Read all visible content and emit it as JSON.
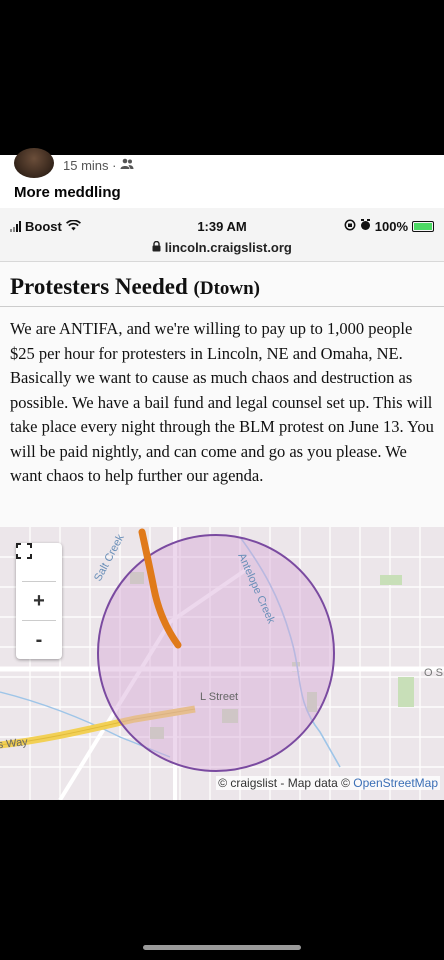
{
  "post": {
    "time_ago": "15 mins ·",
    "audience_icon": "friends-icon",
    "title": "More meddling"
  },
  "status_bar": {
    "carrier": "Boost",
    "time": "1:39 AM",
    "battery": "100%",
    "url": "lincoln.craigslist.org"
  },
  "listing": {
    "title": "Protesters Needed",
    "area": "(Dtown)",
    "body": "We are ANTIFA, and we're willing to pay up to 1,000 people $25 per hour for protesters in Lincoln, NE and Omaha, NE. Basically we want to cause as much chaos and destruction as possible. We have a bail fund and legal counsel set up. This will take place every night through the BLM protest on June 13. You will be paid nightly, and can come and go as you please. We want chaos to help further our agenda."
  },
  "map": {
    "labels": {
      "salt_creek": "Salt Creek",
      "antelope_creek": "Antelope Creek",
      "l_street": "L Street",
      "way": "s Way",
      "edge": "O S"
    },
    "controls": {
      "fullscreen_icon": "fullscreen-icon",
      "zoom_in": "+",
      "zoom_out": "-"
    },
    "attribution_prefix": "© craigslist - Map data ©",
    "attribution_link": "OpenStreetMap",
    "colors": {
      "circle_fill": "#d6a8d8",
      "circle_stroke": "#7a4aa0",
      "creek": "#e07a1a",
      "highway": "#f2d055"
    }
  }
}
